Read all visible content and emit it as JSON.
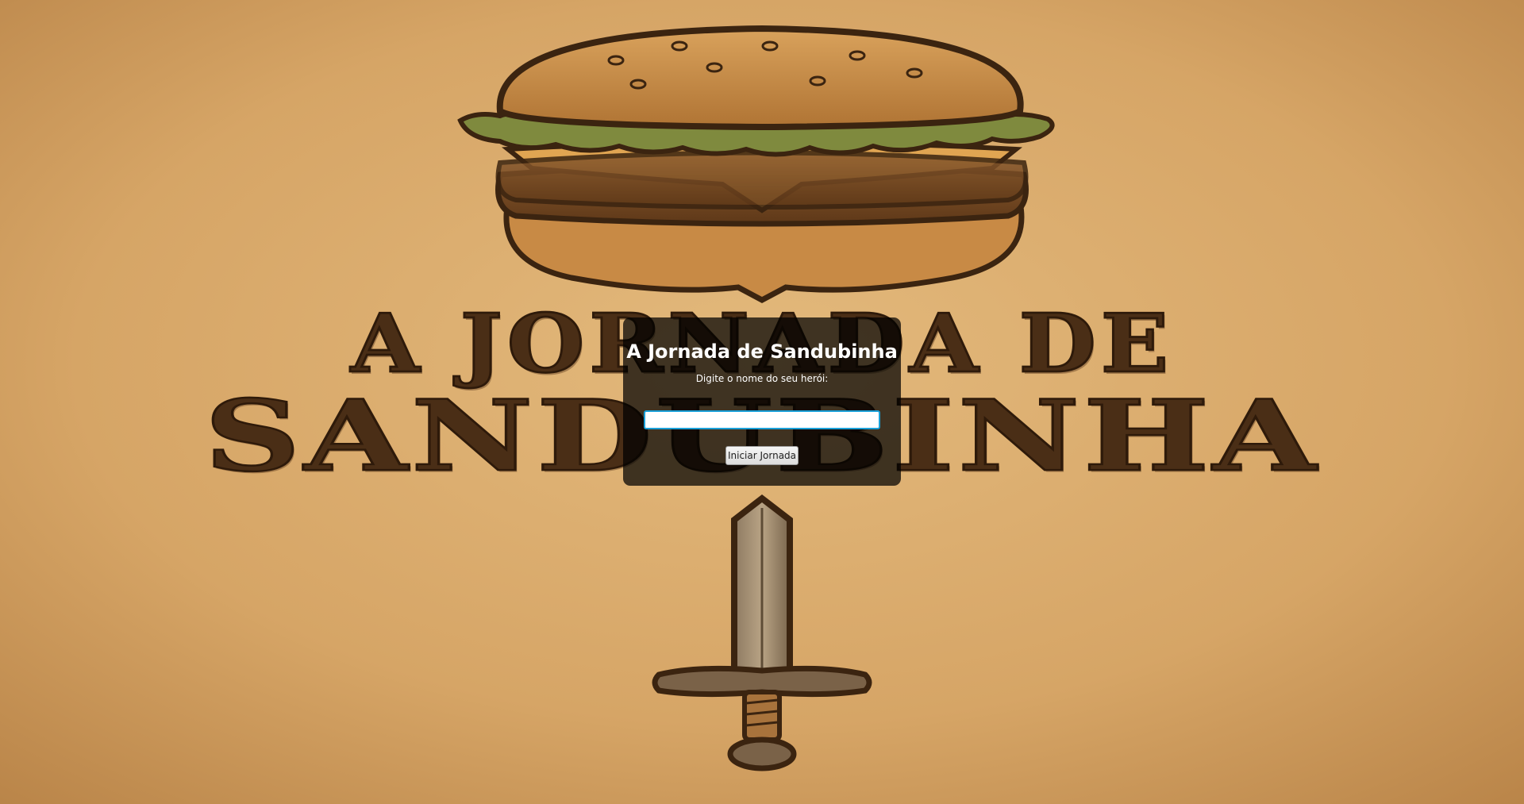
{
  "background": {
    "art_title_line1": "A JORNADA DE",
    "art_title_line2": "SANDUBINHA",
    "icons": [
      "hamburger-icon",
      "sword-icon"
    ]
  },
  "modal": {
    "title": "A Jornada de Sandubinha",
    "prompt": "Digite o nome do seu herói:",
    "input_value": "",
    "input_placeholder": "",
    "start_button_label": "Iniciar Jornada"
  },
  "colors": {
    "parchment": "#d9a86a",
    "ink": "#4a2e16",
    "overlay": "rgba(0,0,0,0.72)",
    "input_focus": "#1aa0d8"
  }
}
